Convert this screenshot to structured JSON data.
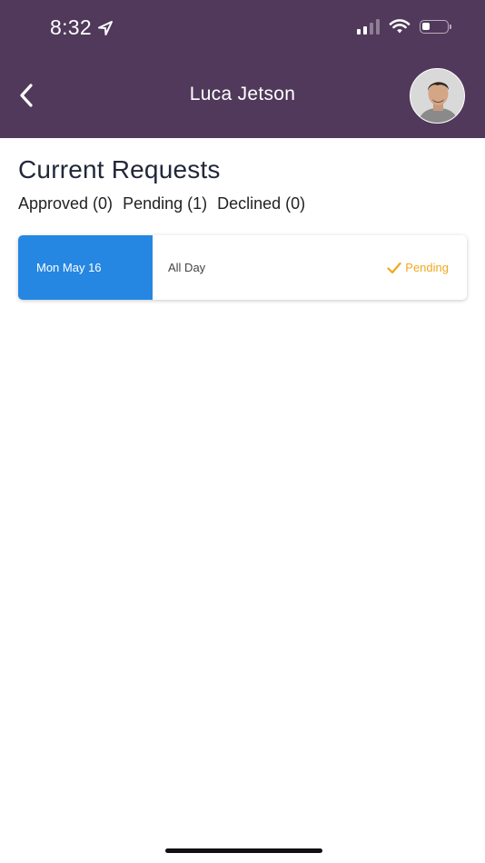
{
  "status_bar": {
    "time": "8:32"
  },
  "header": {
    "title": "Luca Jetson"
  },
  "page": {
    "title": "Current Requests"
  },
  "filters": [
    {
      "label": "Approved (0)"
    },
    {
      "label": "Pending (1)"
    },
    {
      "label": "Declined (0)"
    }
  ],
  "requests": [
    {
      "date": "Mon May 16",
      "duration": "All Day",
      "status": "Pending"
    }
  ],
  "colors": {
    "header_bg": "#51395b",
    "date_block": "#2587e2",
    "pending": "#f2a81d"
  }
}
